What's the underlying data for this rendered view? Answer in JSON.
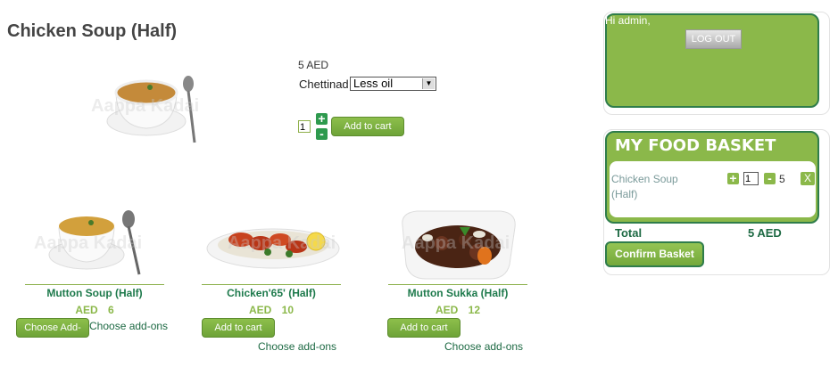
{
  "product": {
    "title": "Chicken Soup (Half)",
    "price": "5 AED",
    "option_label": "Chettinad",
    "option_selected": "Less oil",
    "quantity": "1",
    "add_to_cart": "Add to cart",
    "watermark": "Aappa Kadai"
  },
  "related": [
    {
      "name": "Mutton Soup (Half)",
      "price": "AED 6",
      "button": "Choose Add-ons",
      "addons": "Choose add-ons"
    },
    {
      "name": "Chicken'65' (Half)",
      "price": "AED 10",
      "button": "Add to cart",
      "addons": "Choose add-ons"
    },
    {
      "name": "Mutton Sukka (Half)",
      "price": "AED 12",
      "button": "Add to cart",
      "addons": "Choose add-ons"
    }
  ],
  "account": {
    "greeting": "Hi admin,",
    "logout": "LOG OUT"
  },
  "basket": {
    "title": "MY FOOD BASKET",
    "items": [
      {
        "name": "Chicken Soup (Half)",
        "quantity": "1",
        "price": "5"
      }
    ],
    "remove": "X",
    "total_label": "Total",
    "total_value": "5 AED",
    "confirm": "Confirm Basket"
  },
  "colors": {
    "accent": "#8bb84a",
    "border": "#2f7d4b",
    "link": "#1e6a44"
  }
}
